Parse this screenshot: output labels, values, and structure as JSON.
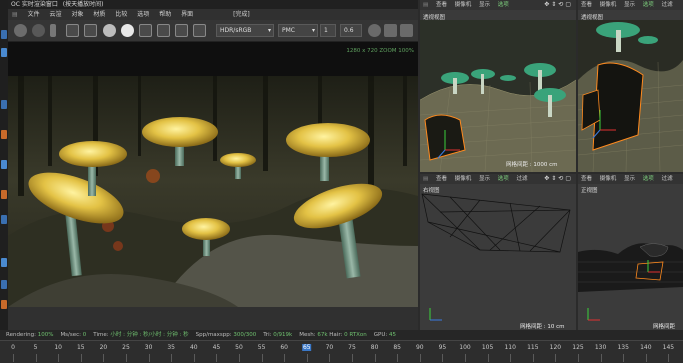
{
  "oc_window": {
    "title": "OC 实时渲染窗口",
    "title_suffix": "(按天播放时间)",
    "menu": [
      "文件",
      "云渲",
      "对象",
      "材质",
      "比较",
      "选项",
      "帮助",
      "界面"
    ],
    "status_tag": "[完成]",
    "color_space": "HDR/sRGB",
    "mode": "PMC",
    "field_a": "1",
    "field_b": "0.6",
    "overlay_text": "1280 x 720 ZOOM 100%"
  },
  "status_bar": {
    "rendering_label": "Rendering:",
    "rendering_value": "100%",
    "ms_sec_label": "Ms/sec:",
    "ms_sec_value": "0",
    "time_label": "Time:",
    "time_value": "小时 : 分钟 : 秒/小时 : 分钟 : 秒",
    "spp_label": "Spp/maxspp:",
    "spp_value": "300/300",
    "tri_label": "Tri:",
    "tri_value": "0/919k",
    "mesh_label": "Mesh:",
    "mesh_value": "67k",
    "hair_label": "Hair:",
    "hair_value": "0",
    "rtx_label": "RTXon",
    "gpu_label": "GPU:",
    "gpu_value": "45"
  },
  "timeline": {
    "ticks": [
      "0",
      "5",
      "10",
      "15",
      "20",
      "25",
      "30",
      "35",
      "40",
      "45",
      "50",
      "55",
      "60",
      "65",
      "70",
      "75",
      "80",
      "85",
      "90",
      "95",
      "100",
      "105",
      "110",
      "115",
      "120",
      "125",
      "130",
      "135",
      "140",
      "145"
    ],
    "current": "65"
  },
  "viewports": {
    "top_left": {
      "menu": [
        "查看",
        "摄像机",
        "显示",
        "选项"
      ],
      "active": "选项",
      "label": "透视视图",
      "footer": "网格间距 : 1000 cm"
    },
    "top_right": {
      "menu": [
        "查看",
        "摄像机",
        "显示",
        "选项",
        "过滤"
      ],
      "active": "选项",
      "label": "透视视图"
    },
    "bottom_left": {
      "menu": [
        "查看",
        "摄像机",
        "显示",
        "选项",
        "过滤"
      ],
      "active": "选项",
      "label": "右视图",
      "footer": "网格间距 : 10 cm"
    },
    "bottom_right": {
      "menu": [
        "查看",
        "摄像机",
        "显示",
        "选项",
        "过滤"
      ],
      "active": "选项",
      "label": "正视图",
      "footer": "网格间距"
    }
  },
  "colors": {
    "accent_green": "#7ed07e",
    "status_green": "#6fc06f",
    "mushroom_yellow": "#e0c040",
    "viewport_teal": "#3aa37a",
    "selection_orange": "#ff8a1e"
  }
}
